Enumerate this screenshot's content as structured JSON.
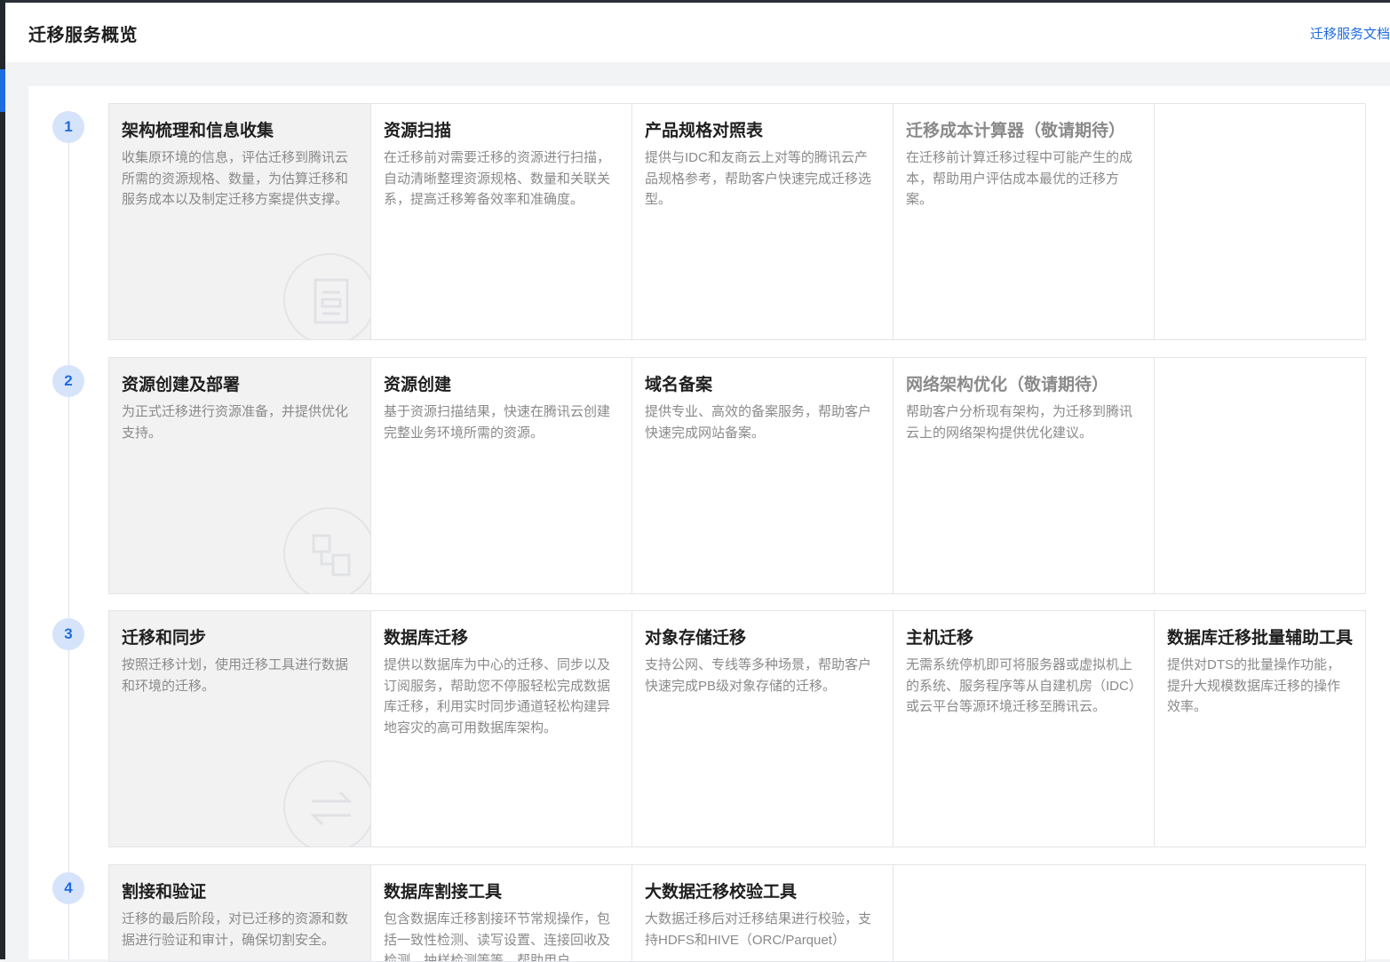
{
  "header": {
    "title": "迁移服务概览",
    "doc_link": "迁移服务文档"
  },
  "stages": [
    {
      "step": "1",
      "title": "架构梳理和信息收集",
      "desc": "收集原环境的信息，评估迁移到腾讯云所需的资源规格、数量，为估算迁移和服务成本以及制定迁移方案提供支撑。",
      "icon": "document-icon",
      "tools": [
        {
          "title": "资源扫描",
          "desc": "在迁移前对需要迁移的资源进行扫描，自动清晰整理资源规格、数量和关联关系，提高迁移筹备效率和准确度。"
        },
        {
          "title": "产品规格对照表",
          "desc": "提供与IDC和友商云上对等的腾讯云产品规格参考，帮助客户快速完成迁移选型。"
        },
        {
          "title": "迁移成本计算器（敬请期待）",
          "desc": "在迁移前计算迁移过程中可能产生的成本，帮助用户评估成本最优的迁移方案。",
          "disabled": true
        }
      ]
    },
    {
      "step": "2",
      "title": "资源创建及部署",
      "desc": "为正式迁移进行资源准备，并提供优化支持。",
      "icon": "structure-icon",
      "tools": [
        {
          "title": "资源创建",
          "desc": "基于资源扫描结果，快速在腾讯云创建完整业务环境所需的资源。"
        },
        {
          "title": "域名备案",
          "desc": "提供专业、高效的备案服务，帮助客户快速完成网站备案。"
        },
        {
          "title": "网络架构优化（敬请期待）",
          "desc": "帮助客户分析现有架构，为迁移到腾讯云上的网络架构提供优化建议。",
          "disabled": true
        }
      ]
    },
    {
      "step": "3",
      "title": "迁移和同步",
      "desc": "按照迁移计划，使用迁移工具进行数据和环境的迁移。",
      "icon": "transfer-icon",
      "tools": [
        {
          "title": "数据库迁移",
          "desc": "提供以数据库为中心的迁移、同步以及订阅服务，帮助您不停服轻松完成数据库迁移，利用实时同步通道轻松构建异地容灾的高可用数据库架构。"
        },
        {
          "title": "对象存储迁移",
          "desc": "支持公网、专线等多种场景，帮助客户快速完成PB级对象存储的迁移。"
        },
        {
          "title": "主机迁移",
          "desc": "无需系统停机即可将服务器或虚拟机上的系统、服务程序等从自建机房（IDC）或云平台等源环境迁移至腾讯云。"
        },
        {
          "title": "数据库迁移批量辅助工具",
          "desc": "提供对DTS的批量操作功能，提升大规模数据库迁移的操作效率。"
        }
      ]
    },
    {
      "step": "4",
      "title": "割接和验证",
      "desc": "迁移的最后阶段，对已迁移的资源和数据进行验证和审计，确保切割安全。",
      "icon": "check-icon",
      "tools": [
        {
          "title": "数据库割接工具",
          "desc": "包含数据库迁移割接环节常规操作，包括一致性检测、读写设置、连接回收及检测、抽样检测等等，帮助用户"
        },
        {
          "title": "大数据迁移校验工具",
          "desc": "大数据迁移后对迁移结果进行校验，支持HDFS和HIVE（ORC/Parquet）"
        }
      ]
    }
  ]
}
